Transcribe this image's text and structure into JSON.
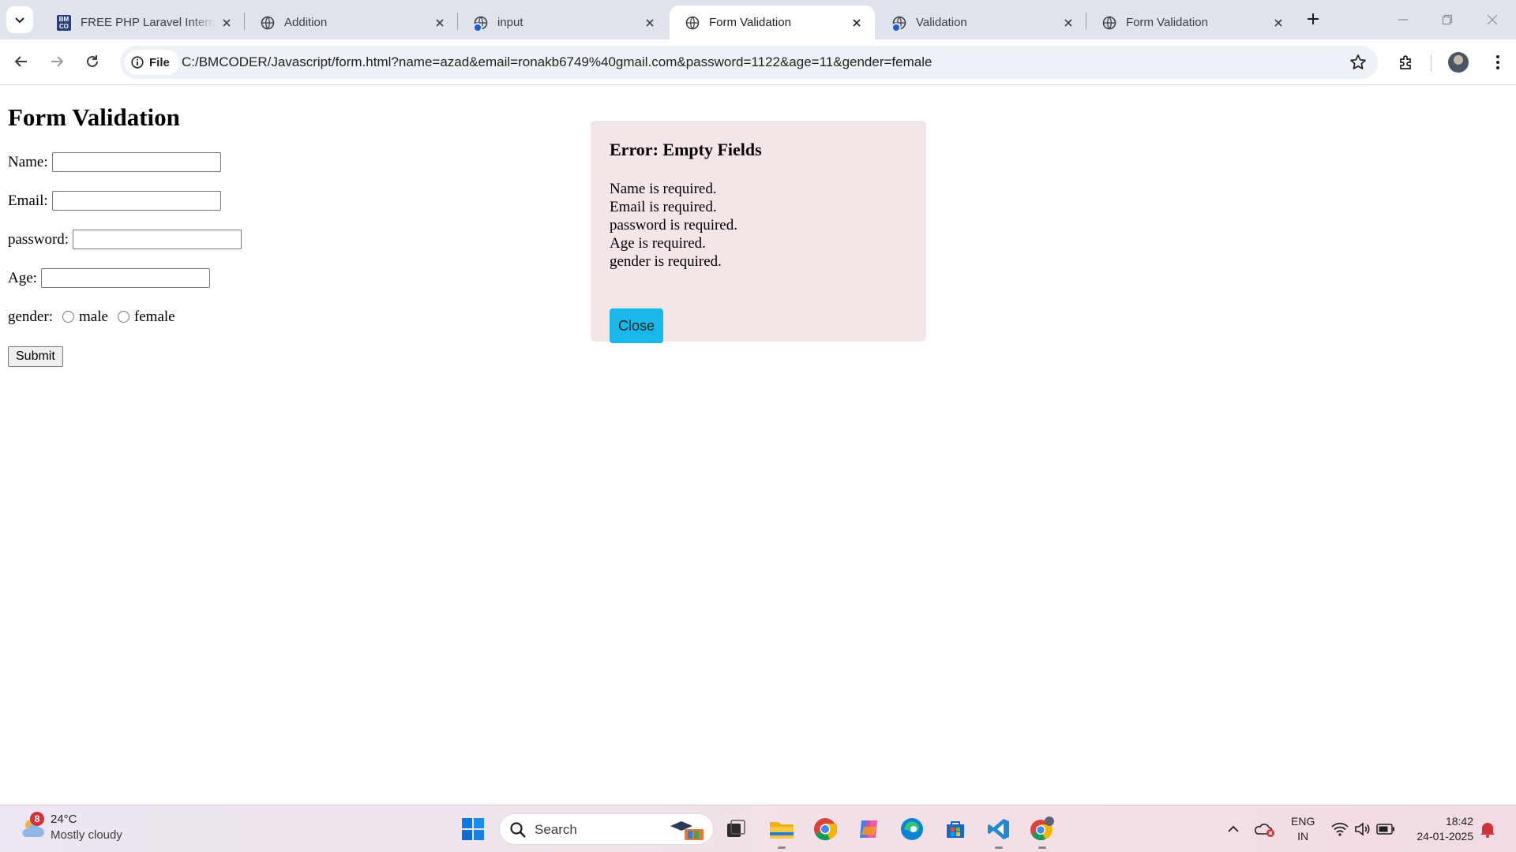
{
  "browser": {
    "tabs": [
      {
        "title": "FREE PHP Laravel Internship",
        "favicon": "bmcoder-logo"
      },
      {
        "title": "Addition",
        "favicon": "globe-icon"
      },
      {
        "title": "input",
        "favicon": "globe-icon"
      },
      {
        "title": "Form Validation",
        "favicon": "globe-icon",
        "active": true
      },
      {
        "title": "Validation",
        "favicon": "globe-icon"
      },
      {
        "title": "Form Validation",
        "favicon": "globe-icon"
      }
    ],
    "favicon_logo_text": "BM CO",
    "site_chip": "File",
    "url": "C:/BMCODER/Javascript/form.html?name=azad&email=ronakb6749%40gmail.com&password=1122&age=11&gender=female"
  },
  "form": {
    "title": "Form Validation",
    "name_label": "Name:",
    "email_label": "Email:",
    "password_label": "password:",
    "age_label": "Age:",
    "gender_label": "gender:",
    "gender_options": [
      "male",
      "female"
    ],
    "submit_label": "Submit"
  },
  "error_modal": {
    "title": "Error: Empty Fields",
    "messages": [
      "Name is required.",
      "Email is required.",
      "password is required.",
      "Age is required.",
      "gender is required."
    ],
    "close_label": "Close",
    "background": "#f2e6e6",
    "button_color": "#1ab7ea"
  },
  "taskbar": {
    "weather": {
      "badge": "8",
      "temp": "24°C",
      "desc": "Mostly cloudy"
    },
    "search_placeholder": "Search",
    "apps": [
      "windows-start-icon",
      "task-view-icon",
      "file-explorer-icon",
      "chrome-icon",
      "copilot-icon",
      "edge-icon",
      "store-icon",
      "vscode-icon",
      "chrome-profile-icon"
    ],
    "language": {
      "line1": "ENG",
      "line2": "IN"
    },
    "clock": {
      "time": "18:42",
      "date": "24-01-2025"
    }
  }
}
